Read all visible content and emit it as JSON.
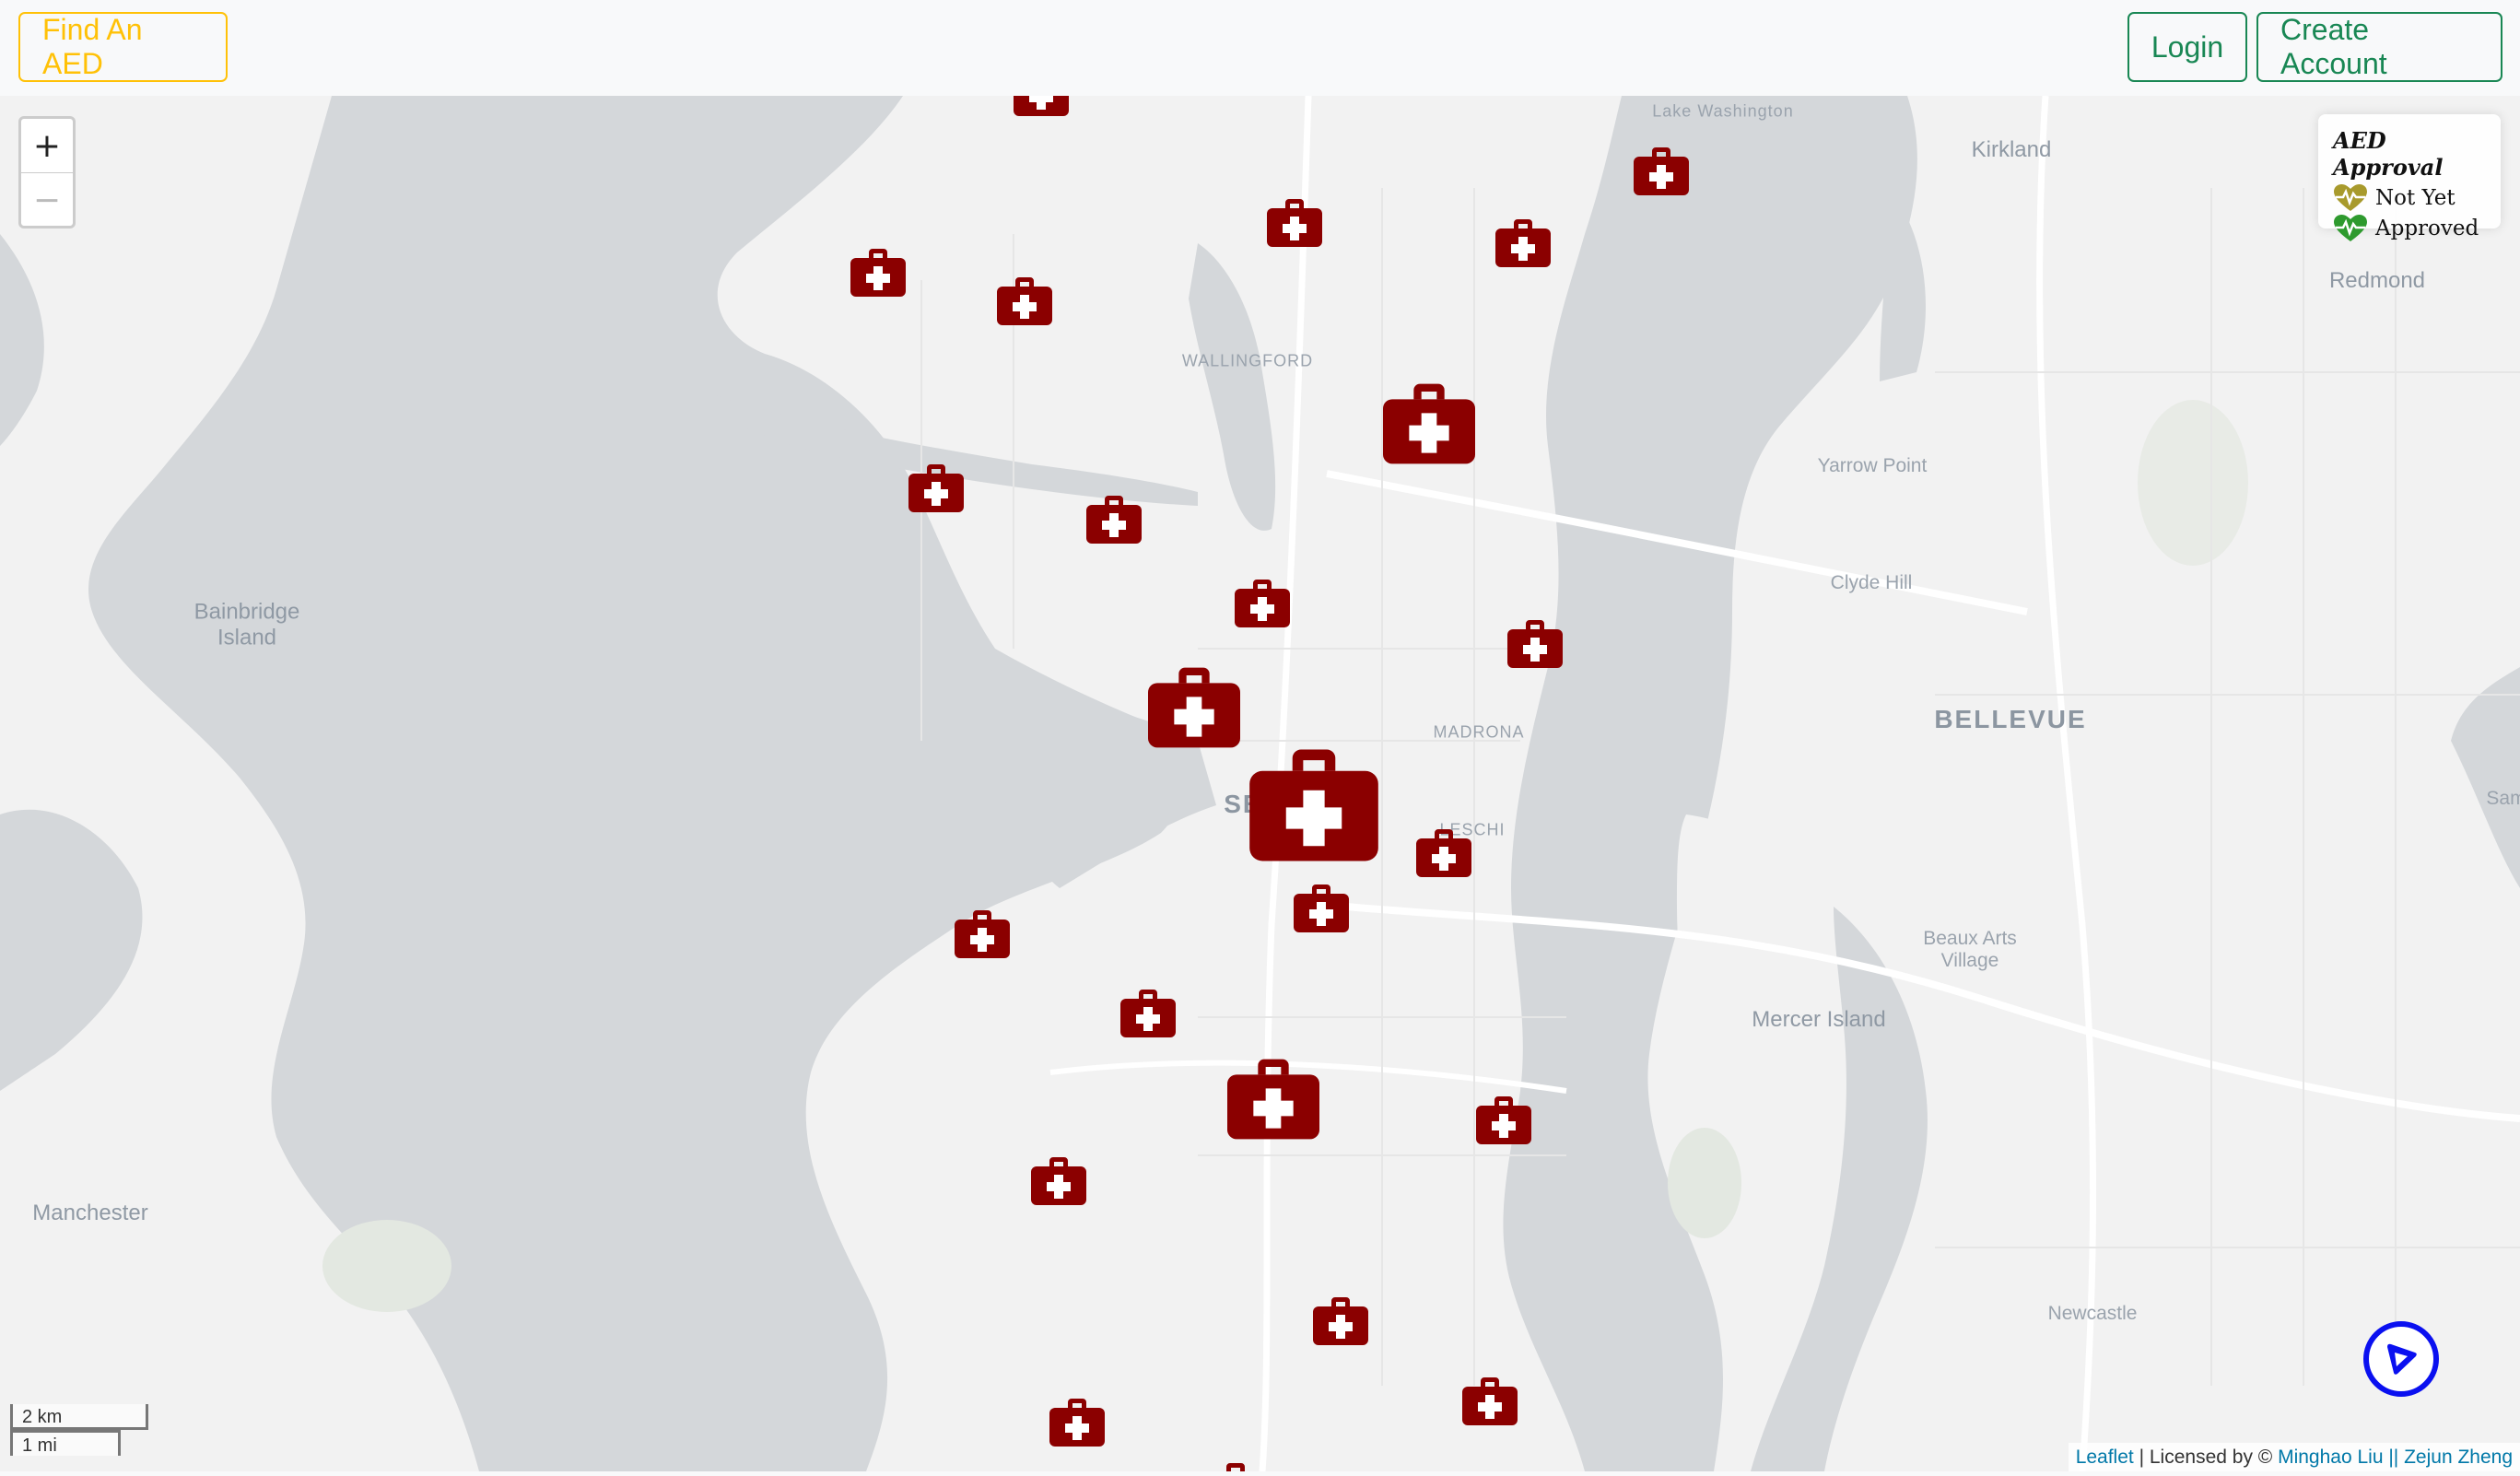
{
  "navbar": {
    "find_label": "Find An AED",
    "login_label": "Login",
    "create_account_label": "Create Account",
    "find_color": "#ffc107",
    "account_color": "#198754"
  },
  "map": {
    "zoom_in": "+",
    "zoom_out": "−",
    "water_color": "#d4d7da",
    "land_color": "#f2f2f2",
    "places": {
      "lake_washington": "Lake Washington",
      "kirkland": "Kirkland",
      "redmond": "Redmond",
      "wallingford": "WALLINGFORD",
      "yarrow_point": "Yarrow Point",
      "clyde_hill": "Clyde Hill",
      "bainbridge": "Bainbridge\nIsland",
      "bellevue": "BELLEVUE",
      "madrona": "MADRONA",
      "seattle": "SEATTLE",
      "leschi": "LESCHI",
      "beaux_arts": "Beaux Arts\nVillage",
      "mercer_island": "Mercer Island",
      "manchester": "Manchester",
      "newcastle": "Newcastle",
      "sammamish": "Sam"
    },
    "marker_color": "#8b0000",
    "marker_icon": "first-aid-kit-icon"
  },
  "legend": {
    "title": "AED Approval",
    "not_yet_label": "Not Yet",
    "approved_label": "Approved",
    "not_yet_color": "#a89a2c",
    "approved_color": "#2e9a2e"
  },
  "scale": {
    "km_label": "2 km",
    "mi_label": "1 mi"
  },
  "attribution": {
    "leaflet": "Leaflet",
    "separator": " | Licensed by © ",
    "authors": "Minghao Liu || Zejun Zheng"
  }
}
